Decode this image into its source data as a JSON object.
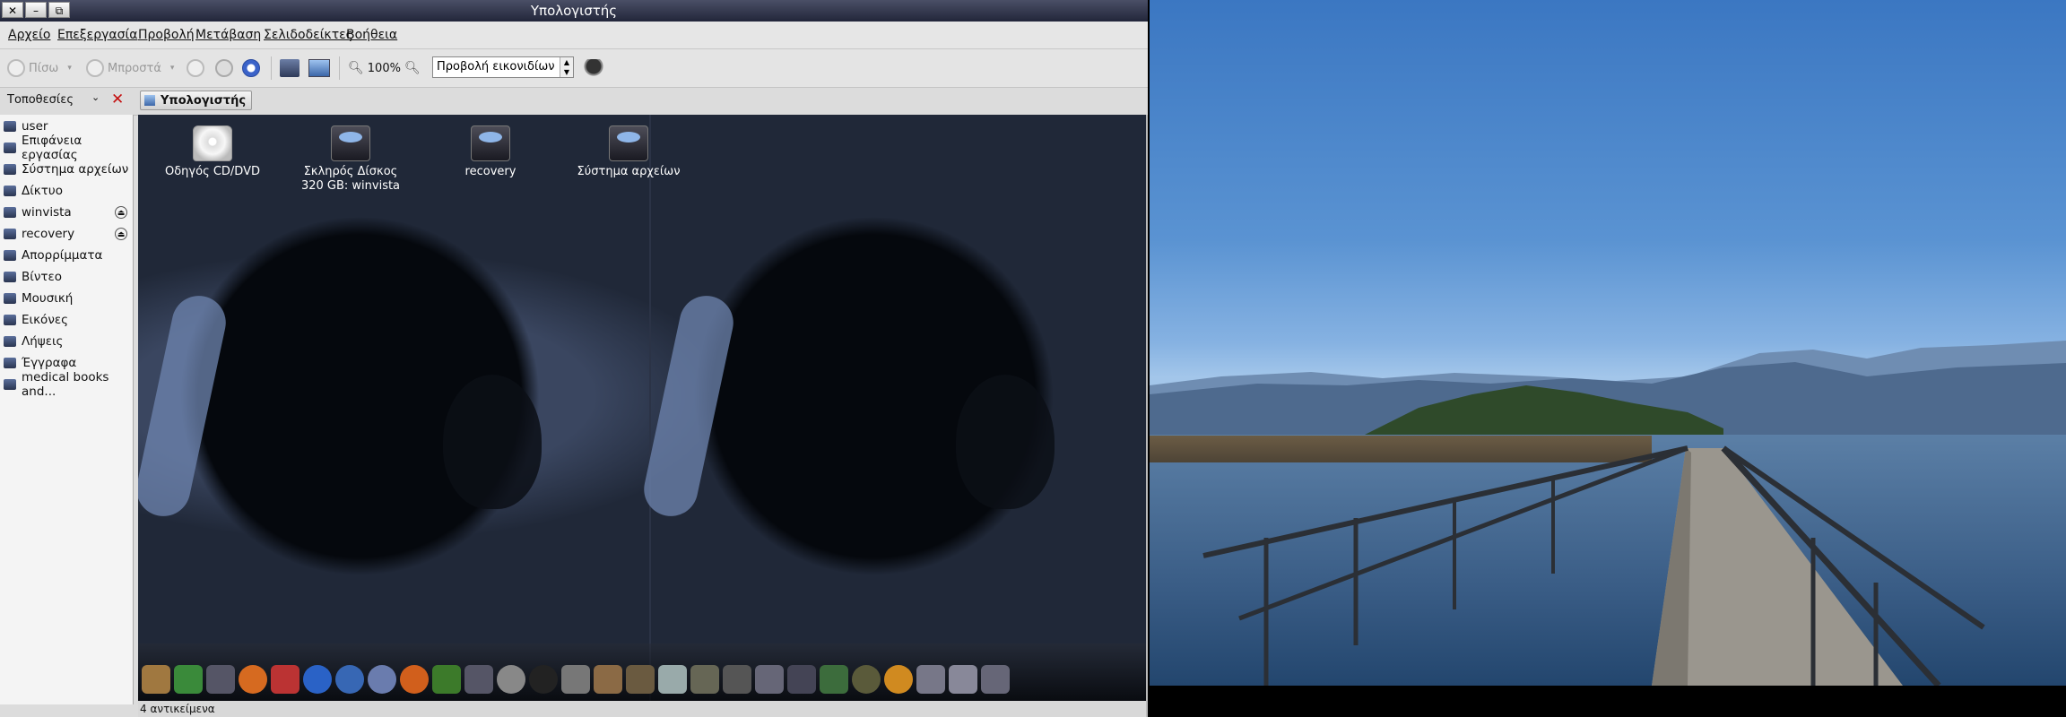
{
  "window": {
    "title": "Υπολογιστής",
    "title_buttons": [
      "✕",
      "–",
      "⧉"
    ]
  },
  "menubar": [
    "Αρχείο",
    "Επεξεργασία",
    "Προβολή",
    "Μετάβαση",
    "Σελιδοδείκτες",
    "Βοήθεια"
  ],
  "toolbar": {
    "back_label": "Πίσω",
    "forward_label": "Μπροστά",
    "zoom_level": "100%",
    "view_mode": "Προβολή εικονιδίων"
  },
  "locationbar": {
    "places_label": "Τοποθεσίες",
    "current_location": "Υπολογιστής"
  },
  "sidebar": {
    "items": [
      {
        "label": "user",
        "eject": false
      },
      {
        "label": "Επιφάνεια εργασίας",
        "eject": false
      },
      {
        "label": "Σύστημα αρχείων",
        "eject": false
      },
      {
        "label": "Δίκτυο",
        "eject": false
      },
      {
        "label": "winvista",
        "eject": true
      },
      {
        "label": "recovery",
        "eject": true
      },
      {
        "label": "Απορρίμματα",
        "eject": false
      },
      {
        "label": "Βίντεο",
        "eject": false
      },
      {
        "label": "Μουσική",
        "eject": false
      },
      {
        "label": "Εικόνες",
        "eject": false
      },
      {
        "label": "Λήψεις",
        "eject": false
      },
      {
        "label": "Έγγραφα",
        "eject": false
      },
      {
        "label": "medical books and...",
        "eject": false
      }
    ]
  },
  "content": {
    "icons": [
      {
        "label": "Οδηγός CD/DVD",
        "icon": "cd-drive-icon"
      },
      {
        "label": "Σκληρός Δίσκος 320 GB: winvista",
        "icon": "hard-disk-icon"
      },
      {
        "label": "recovery",
        "icon": "hard-disk-icon"
      },
      {
        "label": "Σύστημα αρχείων",
        "icon": "hard-disk-icon"
      }
    ]
  },
  "statusbar": {
    "text": "4 αντικείμενα"
  },
  "colors": {
    "titlebar": "#2b2f44",
    "content_bg": "#1a2130",
    "sky": "#5a93d2",
    "lake": "#3a5d86"
  }
}
